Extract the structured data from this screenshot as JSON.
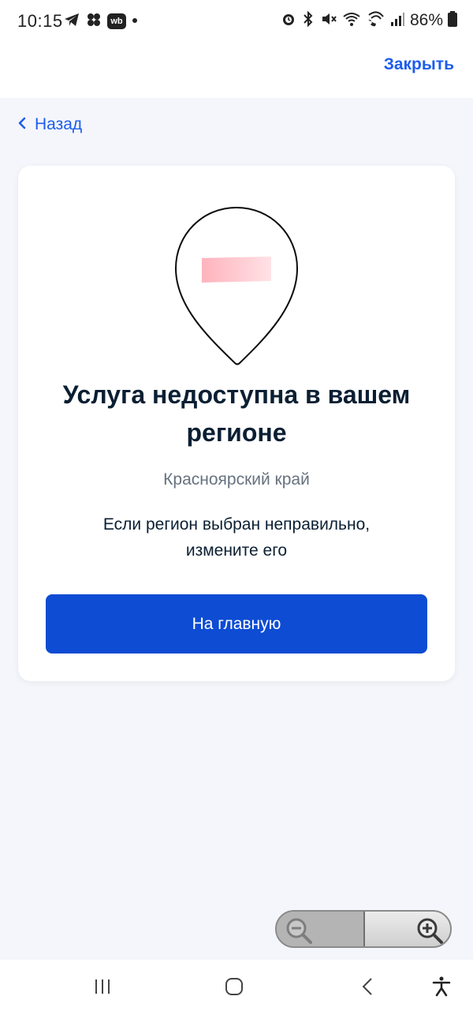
{
  "status_bar": {
    "time": "10:15",
    "left_icons": [
      "telegram-icon",
      "apps-icon",
      "wb-icon",
      "dot-icon"
    ],
    "wb_label": "wb",
    "right_icons": [
      "alarm-icon",
      "bluetooth-icon",
      "mute-icon",
      "wifi-icon",
      "wifi-calling-icon",
      "signal-icon",
      "battery-icon"
    ],
    "battery": "86%"
  },
  "app_bar": {
    "close_label": "Закрыть"
  },
  "back": {
    "label": "Назад"
  },
  "card": {
    "title": "Услуга недоступна в вашем регионе",
    "region": "Красноярский край",
    "hint": "Если регион выбран неправильно, измените его",
    "button_label": "На главную"
  },
  "zoom": {
    "out_icon": "zoom-out-icon",
    "in_icon": "zoom-in-icon"
  },
  "nav_bar": {
    "items": [
      "recent-apps-icon",
      "home-icon",
      "back-icon",
      "accessibility-icon"
    ]
  },
  "colors": {
    "accent": "#0d4cd3",
    "link": "#1d5deb",
    "background": "#f4f6fb",
    "text": "#0b1f33",
    "muted": "#66727f"
  }
}
